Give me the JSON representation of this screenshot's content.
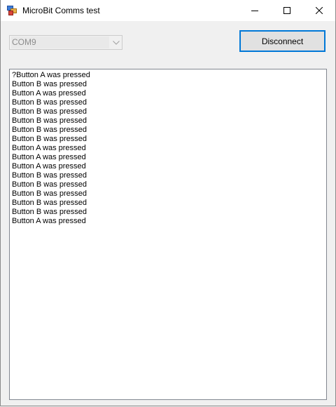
{
  "window": {
    "title": "MicroBit Comms test"
  },
  "port_select": {
    "value": "COM9"
  },
  "disconnect_button": {
    "label": "Disconnect"
  },
  "log": {
    "lines": [
      "?Button A was pressed",
      "Button B was pressed",
      "Button A was pressed",
      "Button B was pressed",
      "Button B was pressed",
      "Button B was pressed",
      "Button B was pressed",
      "Button B was pressed",
      "Button A was pressed",
      "Button A was pressed",
      "Button A was pressed",
      "Button B was pressed",
      "Button B was pressed",
      "Button B was pressed",
      "Button B was pressed",
      "Button B was pressed",
      "Button A was pressed"
    ]
  },
  "icons": {
    "app": "app-window-icon",
    "minimize": "minimize-icon",
    "maximize": "maximize-icon",
    "close": "close-icon",
    "dropdown": "chevron-down-icon"
  },
  "colors": {
    "accent": "#0078d7",
    "window_bg": "#f0f0f0",
    "disabled_text": "#8c8c8c"
  }
}
